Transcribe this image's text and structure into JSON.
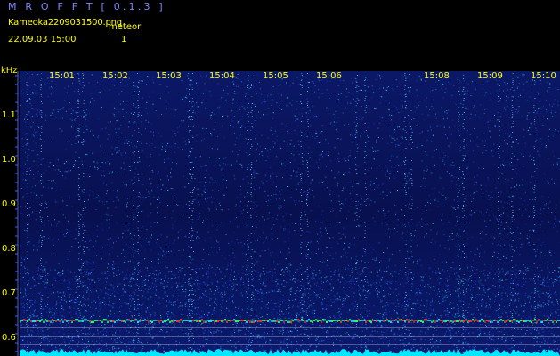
{
  "header": {
    "app_title": "M R O F F T [ 0.1.3 ]",
    "file_name": "Kameoka2209031500.png",
    "meteor_label": "meteor",
    "start_time": "22.09.03 15:00",
    "meteor_count": "1"
  },
  "axis": {
    "unit": "kHz",
    "y_ticks": [
      "1.1",
      "1.0",
      "0.9",
      "0.8",
      "0.7",
      "0.6"
    ],
    "x_ticks": [
      "15:01",
      "15:02",
      "15:03",
      "15:04",
      "15:05",
      "15:06",
      "15:08",
      "15:09",
      "15:10"
    ]
  },
  "colors": {
    "background": "#000000",
    "label_text": "#ffff00",
    "title_text": "#7f86ff",
    "spectrogram_base": "#0a1460",
    "noise_band": "#00ffff",
    "echo_mark": "#ff3030"
  }
}
